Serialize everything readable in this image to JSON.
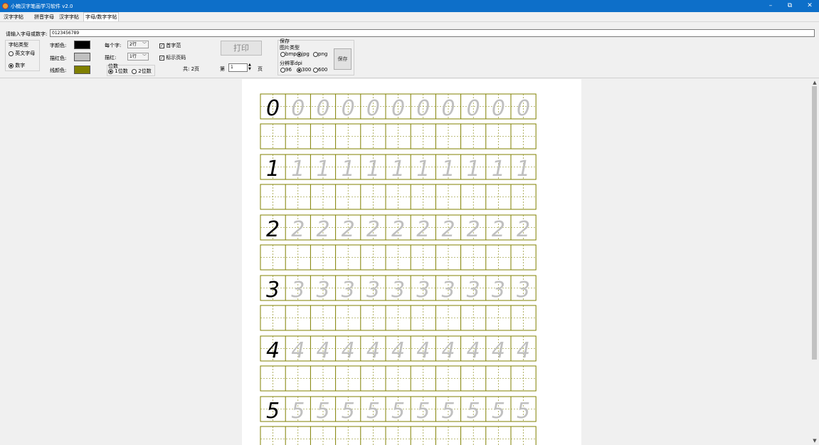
{
  "window": {
    "title": "小楠汉字笔画学习软件 v2.0",
    "minimize_glyph": "–",
    "restore_glyph": "⧉",
    "close_glyph": "✕"
  },
  "tabs": [
    {
      "label": "汉字字帖"
    },
    {
      "label": "拼音字母"
    },
    {
      "label": "汉字字帖"
    },
    {
      "label": "字母/数字字帖"
    }
  ],
  "input": {
    "label": "请输入字母或数字:",
    "value": "0123456789"
  },
  "char_type": {
    "label": "字帖类型",
    "options": [
      {
        "label": "英文字母",
        "selected": false
      },
      {
        "label": "数字",
        "selected": true
      }
    ]
  },
  "colors": {
    "font_label": "字颜色:",
    "font_color": "#000000",
    "trace_label": "描红色:",
    "trace_color": "#c0c0c0",
    "line_label": "线颜色:",
    "line_color": "#808000"
  },
  "per_char": {
    "label": "每个字:",
    "value": "2行"
  },
  "trace": {
    "label": "描红:",
    "value": "1行"
  },
  "digits": {
    "label": "位数",
    "options": [
      {
        "label": "1位数",
        "selected": true
      },
      {
        "label": "2位数",
        "selected": false
      }
    ]
  },
  "checks": [
    {
      "label": "首字范",
      "checked": true
    },
    {
      "label": "标示页码",
      "checked": true
    }
  ],
  "page_info": {
    "total": "共: 2页",
    "prefix": "第",
    "current": "1",
    "suffix": "页"
  },
  "print_button": "打印",
  "save": {
    "label": "保存",
    "image_type_label": "图片类型",
    "image_types": [
      {
        "label": "bmp",
        "selected": false
      },
      {
        "label": "jpg",
        "selected": true
      },
      {
        "label": "png",
        "selected": false
      }
    ],
    "dpi_label": "分辨率dpi",
    "dpi_options": [
      {
        "label": "96",
        "selected": false
      },
      {
        "label": "300",
        "selected": true
      },
      {
        "label": "600",
        "selected": false
      }
    ],
    "button": "保存"
  },
  "worksheet": {
    "digits": [
      "0",
      "1",
      "2",
      "3",
      "4",
      "5"
    ],
    "cells_per_row": 11,
    "cell_line_color": "#808000",
    "first_char_color": "#000000",
    "trace_char_color": "#c0c0c0"
  }
}
